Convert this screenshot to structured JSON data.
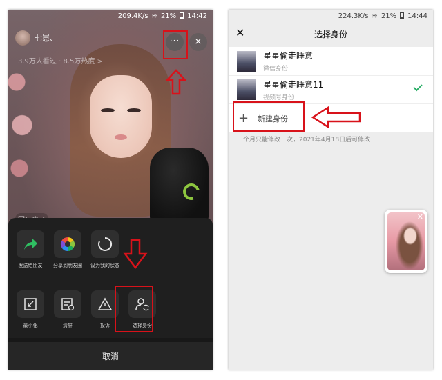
{
  "left_phone": {
    "status": {
      "speed": "209.4K/s",
      "battery": "21%",
      "time": "14:42"
    },
    "host_name": "七崽、",
    "viewers": "3.9万人看过 · 8.5万热度 >",
    "comment_tag": "回**来了",
    "more_label": "···",
    "close_label": "×",
    "share_items": [
      {
        "icon": "share-arrow-icon",
        "label": "发送给朋友"
      },
      {
        "icon": "moments-icon",
        "label": "分享到朋友圈"
      },
      {
        "icon": "status-circle-icon",
        "label": "设为我的状态"
      }
    ],
    "action_items": [
      {
        "icon": "minimize-icon",
        "label": "最小化"
      },
      {
        "icon": "clear-screen-icon",
        "label": "清屏"
      },
      {
        "icon": "warning-icon",
        "label": "投诉"
      },
      {
        "icon": "switch-identity-icon",
        "label": "选择身份"
      }
    ],
    "cancel_label": "取消"
  },
  "right_phone": {
    "status": {
      "speed": "224.3K/s",
      "battery": "21%",
      "time": "14:44"
    },
    "close_label": "✕",
    "title": "选择身份",
    "identities": [
      {
        "name": "星星偷走睡意",
        "type": "微信身份",
        "selected": false
      },
      {
        "name": "星星偷走睡意11",
        "type": "视频号身份",
        "selected": true
      }
    ],
    "new_identity_label": "新建身份",
    "note": "一个月只能修改一次，2021年4月18日后可修改",
    "floating_close": "✕"
  },
  "colors": {
    "highlight_red": "#d8121a",
    "check_green": "#2aae67",
    "sheet_bg": "#1f1f1f"
  }
}
